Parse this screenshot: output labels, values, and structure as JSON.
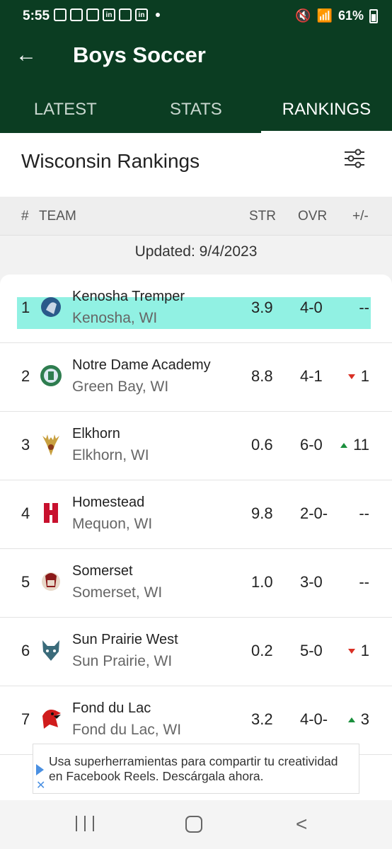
{
  "status": {
    "time": "5:55",
    "battery": "61%"
  },
  "header": {
    "back": "←",
    "title": "Boys Soccer"
  },
  "tabs": [
    "LATEST",
    "STATS",
    "RANKINGS"
  ],
  "subheader": {
    "title": "Wisconsin Rankings"
  },
  "columns": {
    "rank": "#",
    "team": "TEAM",
    "str": "STR",
    "ovr": "OVR",
    "change": "+/-"
  },
  "updated": "Updated: 9/4/2023",
  "rankings": [
    {
      "rank": "1",
      "team": "Kenosha Tremper",
      "location": "Kenosha, WI",
      "str": "3.9",
      "ovr": "4-0",
      "change": "--",
      "trend": "none",
      "logo_color": "#2a5a8a"
    },
    {
      "rank": "2",
      "team": "Notre Dame Academy",
      "location": "Green Bay, WI",
      "str": "8.8",
      "ovr": "4-1",
      "change": "1",
      "trend": "down",
      "logo_color": "#2e7d4f"
    },
    {
      "rank": "3",
      "team": "Elkhorn",
      "location": "Elkhorn, WI",
      "str": "0.6",
      "ovr": "6-0",
      "change": "11",
      "trend": "up",
      "logo_color": "#c8a040"
    },
    {
      "rank": "4",
      "team": "Homestead",
      "location": "Mequon, WI",
      "str": "9.8",
      "ovr": "2-0-",
      "change": "--",
      "trend": "none",
      "logo_color": "#c8102e"
    },
    {
      "rank": "5",
      "team": "Somerset",
      "location": "Somerset, WI",
      "str": "1.0",
      "ovr": "3-0",
      "change": "--",
      "trend": "none",
      "logo_color": "#8b1a1a"
    },
    {
      "rank": "6",
      "team": "Sun Prairie West",
      "location": "Sun Prairie, WI",
      "str": "0.2",
      "ovr": "5-0",
      "change": "1",
      "trend": "down",
      "logo_color": "#3a6b7a"
    },
    {
      "rank": "7",
      "team": "Fond du Lac",
      "location": "Fond du Lac, WI",
      "str": "3.2",
      "ovr": "4-0-",
      "change": "3",
      "trend": "up",
      "logo_color": "#d01c1c"
    }
  ],
  "ad": {
    "text": "Usa superherramientas para compartir tu creatividad en Facebook Reels. Descárgala ahora."
  },
  "colors": {
    "header_bg": "#0b3d22",
    "highlight": "#7eeede",
    "up": "#1a8f3c",
    "down": "#d93025"
  }
}
